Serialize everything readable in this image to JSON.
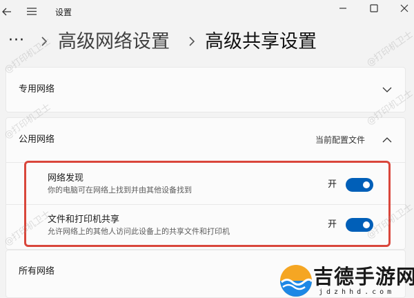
{
  "titlebar": {
    "title": "设置",
    "icons": [
      "back-arrow-icon",
      "hamburger-menu-icon",
      "minimize-icon",
      "maximize-icon",
      "close-icon"
    ]
  },
  "breadcrumb": {
    "overflow": "···",
    "items": [
      "高级网络设置",
      "高级共享设置"
    ],
    "separator_icon": "chevron-right-icon"
  },
  "sections": {
    "private": {
      "label": "专用网络",
      "expanded": false
    },
    "public": {
      "label": "公用网络",
      "profile_status": "当前配置文件",
      "expanded": true,
      "settings": [
        {
          "title": "网络发现",
          "description": "你的电脑可在网络上找到并由其他设备找到",
          "state_label": "开",
          "on": true
        },
        {
          "title": "文件和打印机共享",
          "description": "允许网络上的其他人访问此设备上的共享文件和打印机",
          "state_label": "开",
          "on": true
        }
      ]
    },
    "all": {
      "label": "所有网络",
      "expanded": false
    }
  },
  "watermark": {
    "text": "@打印机卫士",
    "logo_text": "吉德手游网",
    "logo_url": "jdzhhd.com"
  },
  "colors": {
    "accent": "#005fb8",
    "highlight": "#d9463b",
    "background": "#f3f3f3",
    "card": "#fbfbfb"
  }
}
